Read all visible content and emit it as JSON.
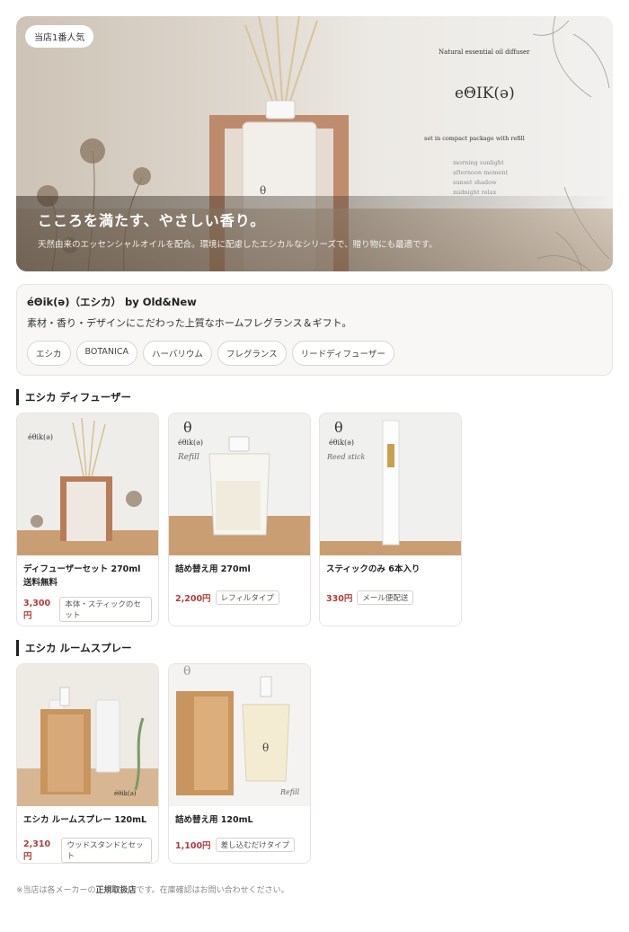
{
  "hero": {
    "badge": "当店1番人気",
    "headline": "こころを満たす、やさしい香り。",
    "subtext": "天然由来のエッセンシャルオイルを配合。環境に配慮したエシカルなシリーズで、贈り物にも最適です。",
    "tagline": "Natural essential oil diffuser",
    "brand": "eΘIK(ə)",
    "set_line": "set in compact package with refill",
    "scents": [
      "morning sunlight",
      "afternoon moment",
      "sunset shadow",
      "midnight relax"
    ]
  },
  "info": {
    "title": "éΘik(ə)（エシカ） by Old&New",
    "description": "素材・香り・デザインにこだわった上質なホームフレグランス＆ギフト。",
    "tags": [
      "エシカ",
      "BOTANICA",
      "ハーバリウム",
      "フレグランス",
      "リードディフューザー"
    ]
  },
  "sections": [
    {
      "heading": "エシカ ディフューザー",
      "products": [
        {
          "title": "ディフューザーセット 270ml 送料無料",
          "price": "3,300円",
          "note": "本体・スティックのセット",
          "image_icon": "diffuser-set-image"
        },
        {
          "title": "詰め替え用 270ml",
          "price": "2,200円",
          "note": "レフィルタイプ",
          "image_icon": "refill-pouch-image"
        },
        {
          "title": "スティックのみ 6本入り",
          "price": "330円",
          "note": "メール便配送",
          "image_icon": "reed-stick-image"
        }
      ]
    },
    {
      "heading": "エシカ ルームスプレー",
      "products": [
        {
          "title": "エシカ ルームスプレー 120mL",
          "price": "2,310円",
          "note": "ウッドスタンドとセット",
          "image_icon": "room-spray-image"
        },
        {
          "title": "詰め替え用 120mL",
          "price": "1,100円",
          "note": "差し込むだけタイプ",
          "image_icon": "spray-refill-image"
        }
      ]
    }
  ],
  "image_labels": {
    "brand_small": "éθik(ə)",
    "theta": "θ",
    "refill_script": "Refill",
    "reed_script": "Reed stick"
  },
  "footer": {
    "prefix": "※当店は各メーカーの",
    "emphasis": "正規取扱店",
    "suffix": "です。在庫確認はお問い合わせください。"
  },
  "colors": {
    "price": "#b23b3b",
    "accent_bar": "#222222",
    "info_bg": "#f8f7f5"
  }
}
